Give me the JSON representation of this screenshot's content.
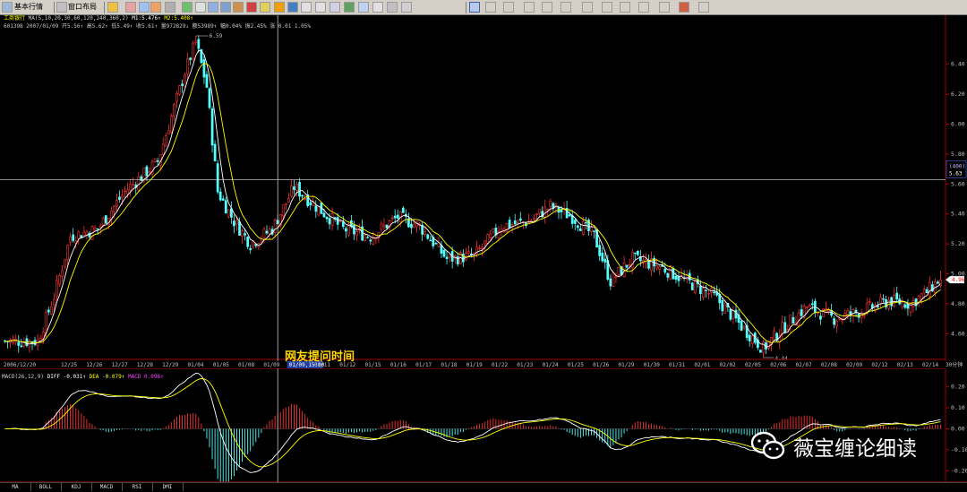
{
  "toolbar": {
    "basic_quote": "基本行情",
    "window_layout": "窗口布局"
  },
  "header": {
    "stock_name": "工商银行",
    "ma_line": "MA(5,10,20,30,60,120,240,360,2)",
    "m1": "M1:5.476↑",
    "m2": "M2:5.408↑",
    "info_line": "601398  2007/01/09  开5.56↑ 高5.62↑ 低5.49↑ 收5.61↑ 量972829↓ 额53989↑ 幅0.04% 振2.45% 涨 0.01 1.05%"
  },
  "macd_header": {
    "title": "MACD(26,12,9)",
    "diff": "DIFF -0.031↑",
    "dea": "DEA -0.079↑",
    "macd": "MACD 0.096↑"
  },
  "price_axis": [
    "6.40",
    "6.20",
    "6.00",
    "5.80",
    "5.60",
    "5.40",
    "5.20",
    "5.00",
    "4.80",
    "4.60"
  ],
  "macd_axis": [
    "0.20",
    "0.10",
    "0.00",
    "-0.10",
    "-0.20"
  ],
  "dates": [
    "2006/12/20",
    "12/25",
    "12/26",
    "12/27",
    "12/28",
    "12/29",
    "01/04",
    "01/05",
    "01/08",
    "01/09",
    "01/09,15:00",
    "01/11",
    "01/12",
    "01/15",
    "01/16",
    "01/17",
    "01/18",
    "01/19",
    "01/22",
    "01/23",
    "01/24",
    "01/25",
    "01/26",
    "01/29",
    "01/30",
    "01/31",
    "02/01",
    "02/02",
    "02/05",
    "02/06",
    "02/07",
    "02/08",
    "02/09",
    "02/12",
    "02/13",
    "02/14",
    "30分钟"
  ],
  "markers": {
    "high": "6.59",
    "low": "4.44",
    "last": "4.96"
  },
  "crosshair_label": {
    "period": "(400)",
    "price": "5.63"
  },
  "annotation": "网友提问时间",
  "watermark": "薇宝缠论细读",
  "tabs": [
    "MA",
    "BOLL",
    "KDJ",
    "MACD",
    "RSI",
    "DMI"
  ],
  "colors": {
    "up": "#ff3232",
    "down": "#54ffff",
    "ma1": "#ffffff",
    "ma2": "#ffff00",
    "annotation": "#ffd700"
  },
  "chart_data": {
    "type": "candlestick",
    "price_ylim": [
      4.44,
      6.62
    ],
    "macd_ylim": [
      -0.25,
      0.28
    ],
    "anchors": [
      [
        0,
        4.55
      ],
      [
        12,
        4.55
      ],
      [
        18,
        4.85
      ],
      [
        24,
        5.25
      ],
      [
        34,
        5.3
      ],
      [
        44,
        5.55
      ],
      [
        56,
        5.75
      ],
      [
        66,
        6.35
      ],
      [
        70,
        6.55
      ],
      [
        74,
        6.25
      ],
      [
        78,
        5.55
      ],
      [
        84,
        5.35
      ],
      [
        90,
        5.2
      ],
      [
        98,
        5.3
      ],
      [
        106,
        5.58
      ],
      [
        114,
        5.45
      ],
      [
        124,
        5.3
      ],
      [
        134,
        5.25
      ],
      [
        144,
        5.38
      ],
      [
        152,
        5.32
      ],
      [
        162,
        5.1
      ],
      [
        172,
        5.12
      ],
      [
        182,
        5.32
      ],
      [
        192,
        5.35
      ],
      [
        200,
        5.45
      ],
      [
        208,
        5.38
      ],
      [
        216,
        5.25
      ],
      [
        222,
        4.95
      ],
      [
        230,
        5.1
      ],
      [
        240,
        5.05
      ],
      [
        250,
        4.95
      ],
      [
        260,
        4.85
      ],
      [
        270,
        4.65
      ],
      [
        278,
        4.5
      ],
      [
        286,
        4.65
      ],
      [
        294,
        4.78
      ],
      [
        304,
        4.7
      ],
      [
        314,
        4.75
      ],
      [
        324,
        4.82
      ],
      [
        332,
        4.8
      ],
      [
        338,
        4.88
      ],
      [
        343,
        4.97
      ]
    ],
    "crosshair": {
      "bar": 100,
      "price": 5.63
    }
  }
}
